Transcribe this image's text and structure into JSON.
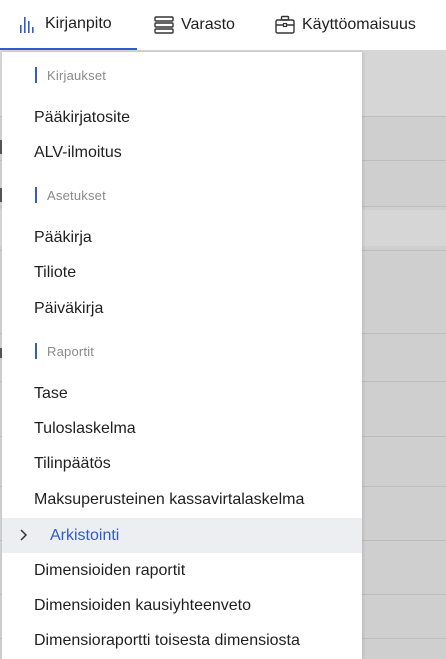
{
  "topbar": {
    "tabs": [
      {
        "label": "Kirjanpito",
        "icon": "bar-chart-icon",
        "active": true
      },
      {
        "label": "Varasto",
        "icon": "stack-icon",
        "active": false
      },
      {
        "label": "Käyttöomaisuus",
        "icon": "briefcase-icon",
        "active": false
      }
    ]
  },
  "dropdown": {
    "sections": [
      {
        "header": "Kirjaukset",
        "items": [
          "Pääkirjatosite",
          "ALV-ilmoitus"
        ]
      },
      {
        "header": "Asetukset",
        "items": [
          "Pääkirja",
          "Tiliote",
          "Päiväkirja"
        ]
      },
      {
        "header": "Raportit",
        "items": [
          "Tase",
          "Tuloslaskelma",
          "Tilinpäätös",
          "Maksuperusteinen kassavirtalaskelma",
          "Arkistointi",
          "Dimensioiden raportit",
          "Dimensioiden kausiyhteenveto",
          "Dimensioraportti toisesta dimensiosta"
        ]
      }
    ],
    "highlighted_item": "Arkistointi"
  },
  "colors": {
    "accent": "#2f5bd3",
    "highlight_bg": "#eceef2",
    "backdrop": "#cfcfcf"
  }
}
